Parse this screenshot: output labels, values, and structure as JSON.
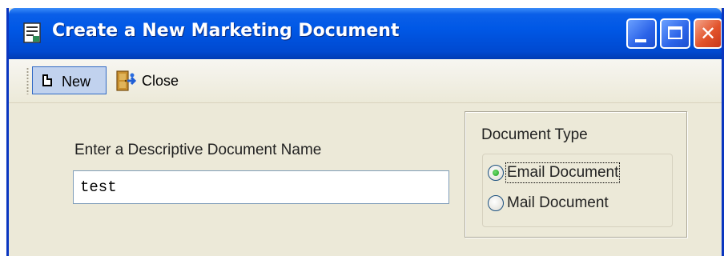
{
  "window": {
    "title": "Create a New Marketing Document",
    "icon": "document-icon",
    "controls": [
      "minimize-icon",
      "maximize-icon",
      "close-icon"
    ]
  },
  "toolbar": {
    "new_label": "New",
    "new_icon": "new-document-icon",
    "close_label": "Close",
    "close_icon": "exit-door-icon"
  },
  "form": {
    "doc_name_label": "Enter a Descriptive Document Name",
    "doc_name_value": "test"
  },
  "document_type": {
    "title": "Document Type",
    "options": [
      {
        "label": "Email Document",
        "selected": true
      },
      {
        "label": "Mail Document",
        "selected": false
      }
    ]
  },
  "colors": {
    "titlebar": "#0058e6",
    "window_bg": "#ece9d8",
    "close_button": "#e2532b",
    "hover_highlight": "#c1d2ee"
  }
}
